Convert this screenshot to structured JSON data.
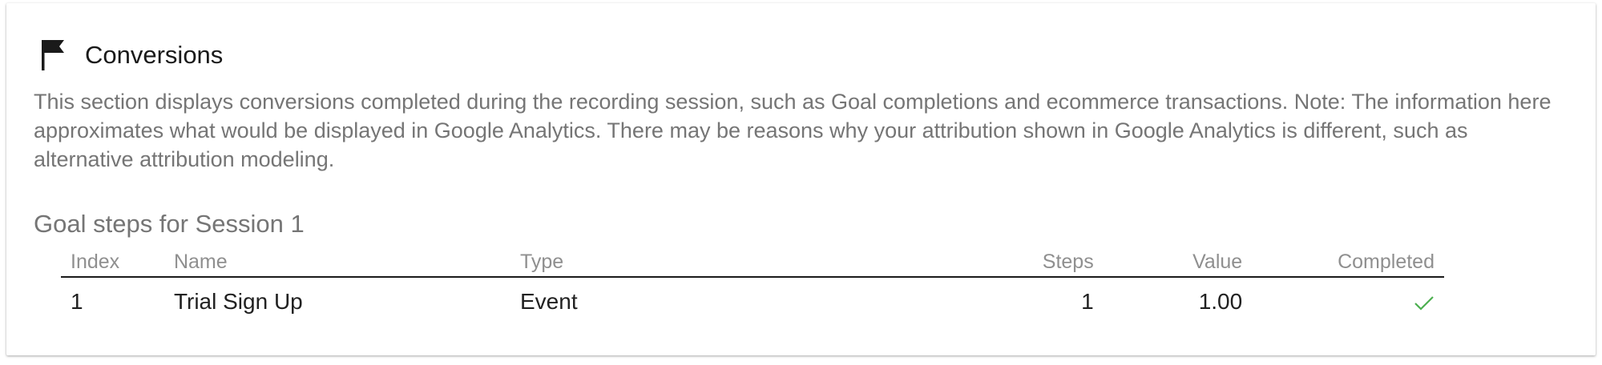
{
  "panel": {
    "title": "Conversions",
    "icon": "flag-icon",
    "description": "This section displays conversions completed during the recording session, such as Goal completions and ecommerce transactions. Note: The information here approximates what would be displayed in Google Analytics. There may be reasons why your attribution shown in Google Analytics is different, such as alternative attribution modeling."
  },
  "goals": {
    "heading": "Goal steps for Session 1",
    "columns": {
      "index": "Index",
      "name": "Name",
      "type": "Type",
      "steps": "Steps",
      "value": "Value",
      "completed": "Completed"
    },
    "rows": [
      {
        "index": "1",
        "name": "Trial Sign Up",
        "type": "Event",
        "steps": "1",
        "value": "1.00",
        "completed": "check-icon"
      }
    ]
  },
  "colors": {
    "check": "#4caf50",
    "muted_text": "#757575",
    "text": "#212121"
  }
}
